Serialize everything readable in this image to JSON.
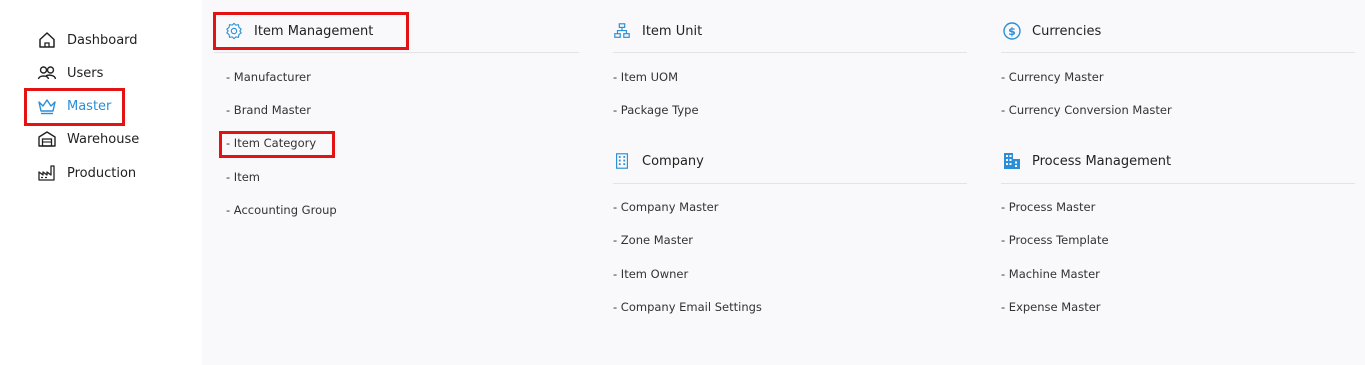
{
  "sidebar": {
    "items": [
      {
        "label": "Dashboard",
        "icon": "home-icon"
      },
      {
        "label": "Users",
        "icon": "users-icon"
      },
      {
        "label": "Master",
        "icon": "crown-icon",
        "active": true
      },
      {
        "label": "Warehouse",
        "icon": "warehouse-icon"
      },
      {
        "label": "Production",
        "icon": "factory-icon"
      }
    ]
  },
  "sections": {
    "item_management": {
      "title": "Item Management",
      "icon": "gear-icon",
      "links": [
        "- Manufacturer",
        "- Brand Master",
        "- Item Category",
        "- Item",
        "- Accounting Group"
      ]
    },
    "item_unit": {
      "title": "Item Unit",
      "icon": "hierarchy-icon",
      "links": [
        "- Item UOM",
        "- Package Type"
      ]
    },
    "company": {
      "title": "Company",
      "icon": "building-icon",
      "links": [
        "- Company Master",
        "- Zone Master",
        "- Item Owner",
        "- Company Email Settings"
      ]
    },
    "currencies": {
      "title": "Currencies",
      "icon": "dollar-circle-icon",
      "links": [
        "- Currency Master",
        "- Currency Conversion Master"
      ]
    },
    "process_management": {
      "title": "Process Management",
      "icon": "city-icon",
      "links": [
        "- Process Master",
        "- Process Template",
        "- Machine Master",
        "- Expense Master"
      ]
    }
  },
  "colors": {
    "accent": "#2a8fd6",
    "highlight": "#e41313"
  }
}
